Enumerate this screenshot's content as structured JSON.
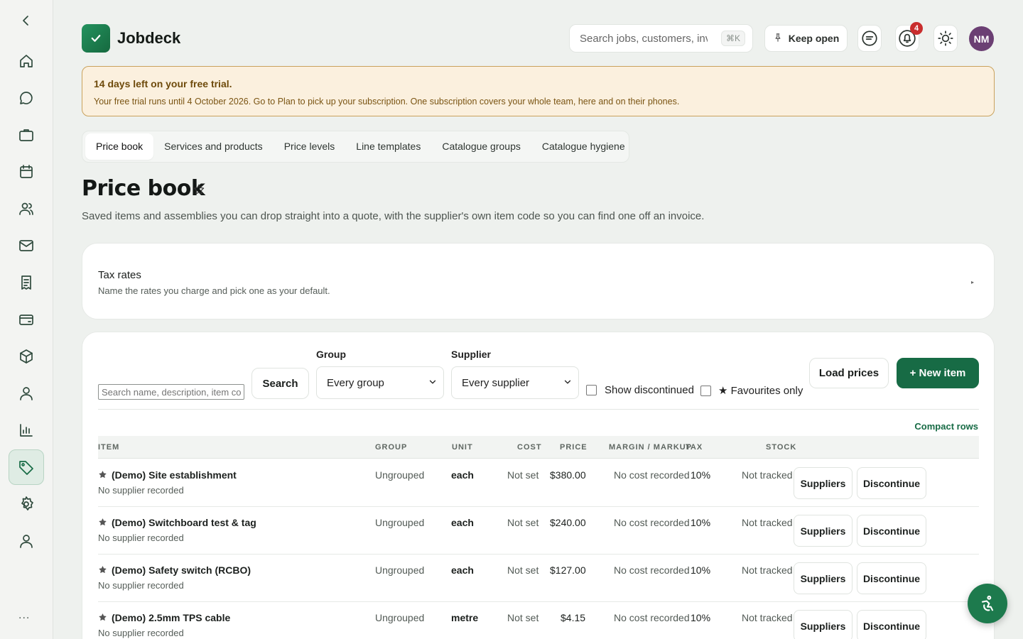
{
  "app": {
    "name": "Jobdeck",
    "user_initials": "NM",
    "notification_count": "4"
  },
  "sidebar": {
    "items": [
      {
        "icon": "chevron-left-icon"
      },
      {
        "icon": "home-icon"
      },
      {
        "icon": "chat-icon"
      },
      {
        "icon": "briefcase-icon"
      },
      {
        "icon": "calendar-icon"
      },
      {
        "icon": "team-icon"
      },
      {
        "icon": "mail-icon"
      },
      {
        "icon": "receipt-icon"
      },
      {
        "icon": "card-icon"
      },
      {
        "icon": "box-icon"
      },
      {
        "icon": "person-icon"
      },
      {
        "icon": "bar-chart-icon"
      },
      {
        "icon": "tag-icon",
        "active": true
      },
      {
        "icon": "gear-icon"
      },
      {
        "icon": "account-icon"
      }
    ],
    "more_label": "..."
  },
  "header": {
    "search_placeholder": "Search jobs, customers, invoices",
    "search_shortcut": "⌘K",
    "keep_open_label": "Keep open"
  },
  "trial_banner": {
    "title": "14 days left on your free trial.",
    "body": "Your free trial runs until 4 October 2026. Go to Plan to pick up your subscription. One subscription covers your whole team, here and on their phones."
  },
  "tabs": [
    {
      "label": "Price book",
      "active": true
    },
    {
      "label": "Services and products"
    },
    {
      "label": "Price levels"
    },
    {
      "label": "Line templates"
    },
    {
      "label": "Catalogue groups"
    },
    {
      "label": "Catalogue hygiene"
    }
  ],
  "page": {
    "title": "Price book",
    "description": "Saved items and assemblies you can drop straight into a quote, with the supplier's own item code so you can find one off an invoice."
  },
  "tax_rates": {
    "title": "Tax rates",
    "subtitle": "Name the rates you charge and pick one as your default.",
    "chevron": "▸"
  },
  "filters": {
    "search_placeholder": "Search name, description, item code",
    "search_button": "Search",
    "group_label": "Group",
    "group_value": "Every group",
    "supplier_label": "Supplier",
    "supplier_value": "Every supplier",
    "show_discontinued_label": "Show discontinued",
    "favourites_only_label": "★ Favourites only",
    "load_prices_button": "Load prices",
    "new_item_button": "+ New item",
    "compact_rows_link": "Compact rows"
  },
  "table": {
    "headers": {
      "item": "ITEM",
      "group": "GROUP",
      "unit": "UNIT",
      "cost": "COST",
      "price": "PRICE",
      "margin": "MARGIN / MARKUP",
      "tax": "TAX",
      "stock": "STOCK"
    },
    "rows": [
      {
        "name": "(Demo) Site establishment",
        "supplier": "No supplier recorded",
        "group": "Ungrouped",
        "unit": "each",
        "cost": "Not set",
        "price": "$380.00",
        "margin": "No cost recorded",
        "tax": "10%",
        "stock": "Not tracked",
        "suppliers_btn": "Suppliers",
        "discontinue_btn": "Discontinue"
      },
      {
        "name": "(Demo) Switchboard test & tag",
        "supplier": "No supplier recorded",
        "group": "Ungrouped",
        "unit": "each",
        "cost": "Not set",
        "price": "$240.00",
        "margin": "No cost recorded",
        "tax": "10%",
        "stock": "Not tracked",
        "suppliers_btn": "Suppliers",
        "discontinue_btn": "Discontinue"
      },
      {
        "name": "(Demo) Safety switch (RCBO)",
        "supplier": "No supplier recorded",
        "group": "Ungrouped",
        "unit": "each",
        "cost": "Not set",
        "price": "$127.00",
        "margin": "No cost recorded",
        "tax": "10%",
        "stock": "Not tracked",
        "suppliers_btn": "Suppliers",
        "discontinue_btn": "Discontinue"
      },
      {
        "name": "(Demo) 2.5mm TPS cable",
        "supplier": "No supplier recorded",
        "group": "Ungrouped",
        "unit": "metre",
        "cost": "Not set",
        "price": "$4.15",
        "margin": "No cost recorded",
        "tax": "10%",
        "stock": "Not tracked",
        "suppliers_btn": "Suppliers",
        "discontinue_btn": "Discontinue"
      }
    ]
  },
  "colors": {
    "brand": "#176b45",
    "trial_border": "#c9a25d",
    "badge": "#c92d2d",
    "avatar": "#6b3f73"
  }
}
